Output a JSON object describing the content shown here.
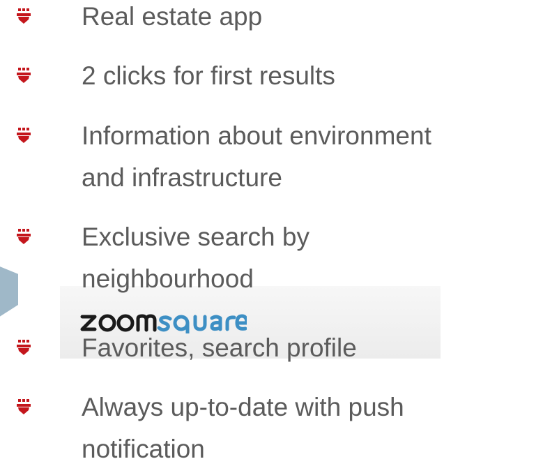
{
  "bullets": [
    {
      "lines": [
        "Real estate app"
      ]
    },
    {
      "lines": [
        "2 clicks for first results"
      ]
    },
    {
      "lines": [
        "Information about environment",
        "and infrastructure"
      ]
    },
    {
      "lines": [
        "Exclusive search by",
        "neighbourhood"
      ]
    },
    {
      "lines": [
        "Favorites, search profile"
      ]
    },
    {
      "lines": [
        "Always up-to-date with push",
        "notification"
      ]
    }
  ],
  "logo": {
    "text": "zoomsquare"
  },
  "colors": {
    "bullet": "#c4161c",
    "text": "#5b5b5b",
    "logo": "#1a1a1a",
    "logo_accent": "#3d8fc4"
  }
}
